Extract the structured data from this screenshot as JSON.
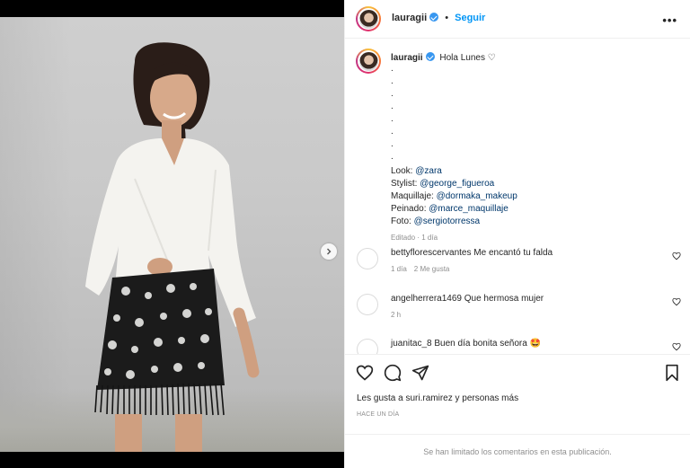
{
  "post": {
    "username": "lauragii",
    "follow_label": "Seguir",
    "more_label": "•••"
  },
  "caption": {
    "username": "lauragii",
    "greeting": "Hola Lunes ♡",
    "dots": [
      ".",
      ".",
      ".",
      ".",
      ".",
      ".",
      ".",
      "."
    ],
    "credits": [
      {
        "label": "Look: ",
        "handle": "@zara"
      },
      {
        "label": "Stylist: ",
        "handle": "@george_figueroa"
      },
      {
        "label": "Maquillaje: ",
        "handle": "@dormaka_makeup"
      },
      {
        "label": "Peinado: ",
        "handle": "@marce_maquillaje"
      },
      {
        "label": "Foto: ",
        "handle": "@sergiotorressa"
      }
    ],
    "meta": "Editado · 1 día"
  },
  "comments": [
    {
      "username": "bettyflorescervantes",
      "text": "Me encantó tu falda",
      "time": "1 día",
      "likes": "2 Me gusta"
    },
    {
      "username": "angelherrera1469",
      "text": "Que hermosa mujer",
      "time": "2 h",
      "likes": ""
    },
    {
      "username": "juanitac_8",
      "text": "Buen día bonita señora 🤩",
      "time": "",
      "likes": ""
    }
  ],
  "footer": {
    "likes_text": "Les gusta a suri.ramirez y personas más",
    "date_text": "HACE UN DÍA",
    "limited_text": "Se han limitado los comentarios en esta publicación."
  },
  "carousel": {
    "slides": 3,
    "current": 1
  },
  "colors": {
    "accent": "#0095f6",
    "verified": "#3897f0",
    "mention": "#00376b",
    "muted": "#8e8e8e"
  }
}
